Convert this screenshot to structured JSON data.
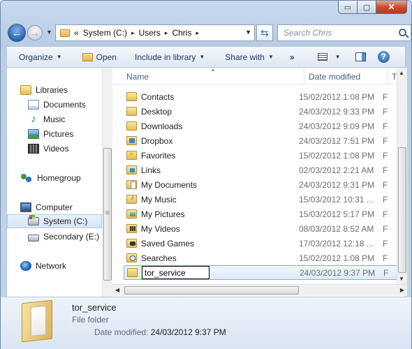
{
  "window": {
    "controls": {
      "minimize": "▭",
      "maximize": "▢",
      "close": "✕"
    }
  },
  "address": {
    "chevron": "«",
    "crumbs": [
      "System (C:)",
      "Users",
      "Chris"
    ],
    "separator": "▸"
  },
  "search": {
    "placeholder": "Search Chris"
  },
  "toolbar": {
    "organize": "Organize",
    "open": "Open",
    "include_in_library": "Include in library",
    "share_with": "Share with",
    "more": "»",
    "help": "?"
  },
  "nav": {
    "libraries": "Libraries",
    "documents": "Documents",
    "music": "Music",
    "pictures": "Pictures",
    "videos": "Videos",
    "homegroup": "Homegroup",
    "computer": "Computer",
    "system_c": "System (C:)",
    "secondary_e": "Secondary (E:)",
    "network": "Network"
  },
  "columns": {
    "name": "Name",
    "date_modified": "Date modified",
    "type": "T"
  },
  "files": [
    {
      "name": "Contacts",
      "date": "15/02/2012 1:08 PM",
      "type": "F",
      "icon": "contacts-folder-icon"
    },
    {
      "name": "Desktop",
      "date": "24/03/2012 9:33 PM",
      "type": "F",
      "icon": "desktop-folder-icon"
    },
    {
      "name": "Downloads",
      "date": "24/03/2012 9:09 PM",
      "type": "F",
      "icon": "downloads-folder-icon"
    },
    {
      "name": "Dropbox",
      "date": "24/03/2012 7:51 PM",
      "type": "F",
      "icon": "dropbox-folder-icon"
    },
    {
      "name": "Favorites",
      "date": "15/02/2012 1:08 PM",
      "type": "F",
      "icon": "favorites-folder-icon"
    },
    {
      "name": "Links",
      "date": "02/03/2012 2:21 AM",
      "type": "F",
      "icon": "links-folder-icon"
    },
    {
      "name": "My Documents",
      "date": "24/03/2012 9:31 PM",
      "type": "F",
      "icon": "documents-folder-icon"
    },
    {
      "name": "My Music",
      "date": "15/03/2012 10:31 ...",
      "type": "F",
      "icon": "music-folder-icon"
    },
    {
      "name": "My Pictures",
      "date": "15/03/2012 5:17 PM",
      "type": "F",
      "icon": "pictures-folder-icon"
    },
    {
      "name": "My Videos",
      "date": "08/03/2012 8:52 AM",
      "type": "F",
      "icon": "videos-folder-icon"
    },
    {
      "name": "Saved Games",
      "date": "17/03/2012 12:18 ...",
      "type": "F",
      "icon": "saved-games-folder-icon"
    },
    {
      "name": "Searches",
      "date": "15/02/2012 1:08 PM",
      "type": "F",
      "icon": "searches-folder-icon"
    },
    {
      "name": "tor_service",
      "date": "24/03/2012 9:37 PM",
      "type": "F",
      "icon": "folder-icon",
      "renaming": true
    }
  ],
  "details": {
    "name": "tor_service",
    "type": "File folder",
    "modified_label": "Date modified:",
    "modified_value": "24/03/2012 9:37 PM"
  },
  "colors": {
    "selection": "#dbeafc",
    "accent": "#1e395b",
    "close": "#c7502f"
  }
}
